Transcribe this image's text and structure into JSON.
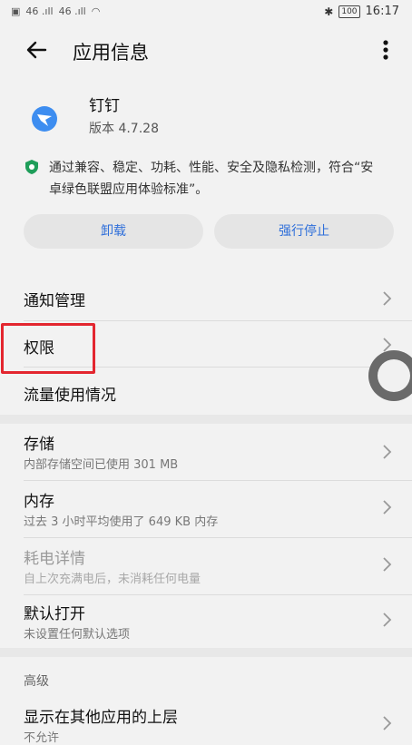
{
  "status": {
    "signal_left": "46 .ıll",
    "signal_right": "46 .ıll",
    "battery": "100",
    "time": "16:17"
  },
  "header": {
    "title": "应用信息"
  },
  "app": {
    "name": "钉钉",
    "version": "版本 4.7.28",
    "verify_text": "通过兼容、稳定、功耗、性能、安全及隐私检测，符合“安卓绿色联盟应用体验标准”。"
  },
  "buttons": {
    "uninstall": "卸载",
    "force_stop": "强行停止"
  },
  "rows": {
    "notifications": {
      "title": "通知管理"
    },
    "permissions": {
      "title": "权限"
    },
    "data_usage": {
      "title": "流量使用情况"
    },
    "storage": {
      "title": "存储",
      "subtitle": "内部存储空间已使用 301 MB"
    },
    "memory": {
      "title": "内存",
      "subtitle": "过去 3 小时平均使用了 649 KB 内存"
    },
    "battery": {
      "title": "耗电详情",
      "subtitle": "自上次充满电后，未消耗任何电量"
    },
    "default_open": {
      "title": "默认打开",
      "subtitle": "未设置任何默认选项"
    },
    "advanced_header": "高级",
    "overlay": {
      "title": "显示在其他应用的上层",
      "subtitle": "不允许"
    }
  },
  "colors": {
    "accent": "#2f6fda",
    "highlight": "#e3262f"
  }
}
